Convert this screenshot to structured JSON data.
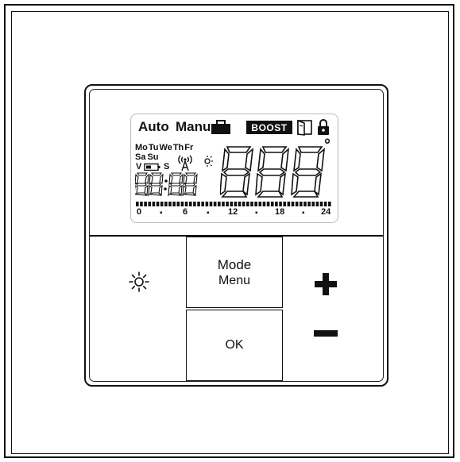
{
  "lcd": {
    "mode_auto": "Auto",
    "mode_manu": "Manu",
    "boost": "BOOST",
    "days_row1": [
      "Mo",
      "Tu",
      "We",
      "Th",
      "Fr"
    ],
    "days_row2": [
      "Sa",
      "Su"
    ],
    "battery_v": "V",
    "signal_s": "S",
    "main_digits": "888",
    "degree": "°",
    "time_digits": "88:88",
    "timeline_labels": [
      "0",
      "6",
      "12",
      "18",
      "24"
    ]
  },
  "buttons": {
    "mode_label": "Mode",
    "menu_label": "Menu",
    "ok_label": "OK"
  },
  "colors": {
    "lcd_ink": "#111111",
    "frame": "#111111",
    "background": "#ffffff"
  }
}
